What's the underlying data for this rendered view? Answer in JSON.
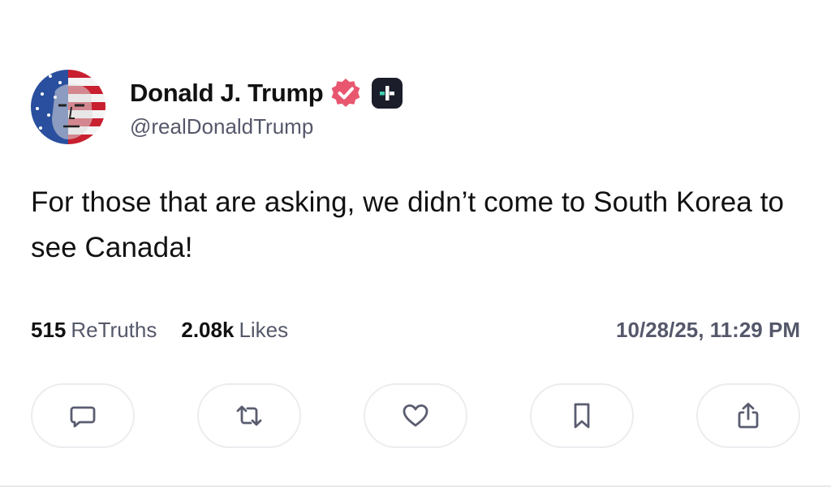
{
  "author": {
    "display_name": "Donald J. Trump",
    "handle": "@realDonaldTrump",
    "verified": true,
    "badge_icons": [
      "verified-check-icon",
      "truth-plus-icon"
    ],
    "verified_color": "#e8576f"
  },
  "post": {
    "text": "For those that are asking, we didn’t come to South Korea to see Canada!"
  },
  "stats": {
    "retruths_count": "515",
    "retruths_label": "ReTruths",
    "likes_count": "2.08k",
    "likes_label": "Likes",
    "timestamp": "10/28/25, 11:29 PM"
  },
  "actions": [
    {
      "name": "reply",
      "icon": "comment-icon"
    },
    {
      "name": "retruth",
      "icon": "repost-icon"
    },
    {
      "name": "like",
      "icon": "heart-icon"
    },
    {
      "name": "bookmark",
      "icon": "bookmark-icon"
    },
    {
      "name": "share",
      "icon": "share-icon"
    }
  ],
  "colors": {
    "text_primary": "#111111",
    "text_secondary": "#55586a",
    "icon_color": "#5a5d70",
    "button_border": "#ececf0",
    "badge_dark": "#1c1d2b"
  }
}
